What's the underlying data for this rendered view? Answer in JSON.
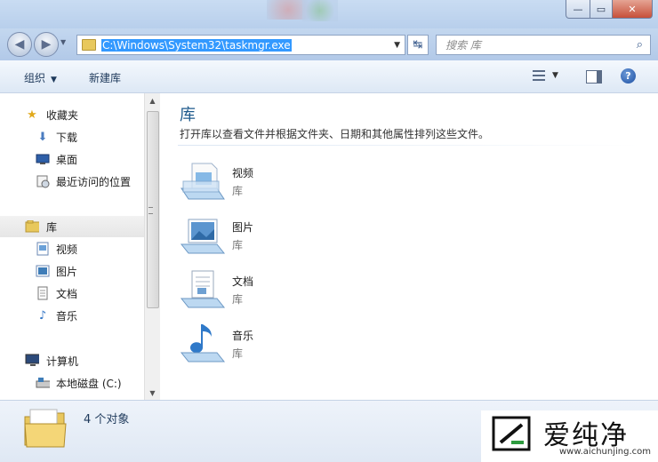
{
  "window": {
    "minimize_icon": "minimize-icon",
    "maximize_icon": "maximize-icon",
    "close_icon": "close-icon"
  },
  "nav": {
    "address": "C:\\Windows\\System32\\taskmgr.exe",
    "search_placeholder": "搜索 库"
  },
  "toolbar": {
    "organize": "组织",
    "new_library": "新建库"
  },
  "sidebar": {
    "favorites": {
      "label": "收藏夹",
      "items": [
        {
          "label": "下载"
        },
        {
          "label": "桌面"
        },
        {
          "label": "最近访问的位置"
        }
      ]
    },
    "libraries": {
      "label": "库",
      "items": [
        {
          "label": "视频"
        },
        {
          "label": "图片"
        },
        {
          "label": "文档"
        },
        {
          "label": "音乐"
        }
      ]
    },
    "computer": {
      "label": "计算机",
      "items": [
        {
          "label": "本地磁盘 (C:)"
        }
      ]
    }
  },
  "main": {
    "title": "库",
    "description": "打开库以查看文件并根据文件夹、日期和其他属性排列这些文件。",
    "libraries": [
      {
        "name": "视频",
        "type": "库",
        "icon": "video-library-icon"
      },
      {
        "name": "图片",
        "type": "库",
        "icon": "picture-library-icon"
      },
      {
        "name": "文档",
        "type": "库",
        "icon": "document-library-icon"
      },
      {
        "name": "音乐",
        "type": "库",
        "icon": "music-library-icon"
      }
    ]
  },
  "details": {
    "count": "4 个对象"
  },
  "watermark": {
    "brand": "爱纯净",
    "url": "www.aichunjing.com"
  },
  "colors": {
    "accent": "#3399ff",
    "title_text": "#1e5a8c",
    "chrome": "#b8cfec"
  }
}
